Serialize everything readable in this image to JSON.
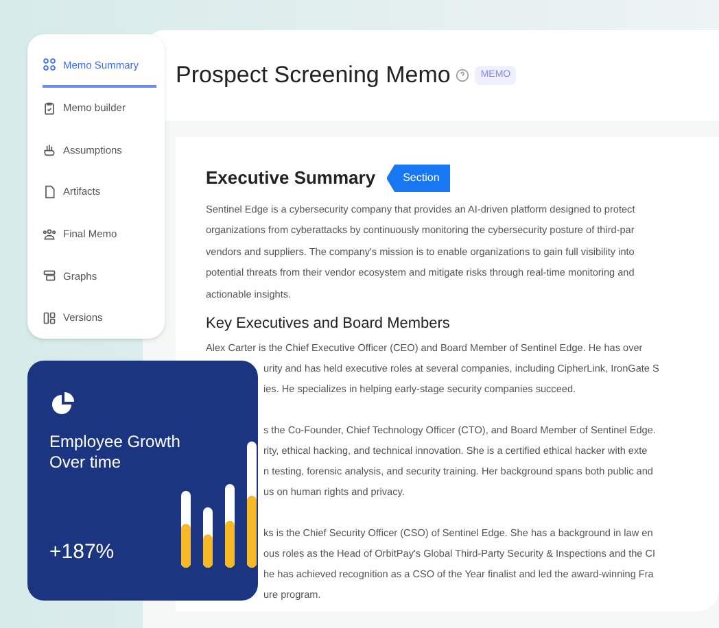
{
  "sidebar": {
    "items": [
      {
        "label": "Memo Summary",
        "selected": true
      },
      {
        "label": "Memo builder",
        "selected": false
      },
      {
        "label": "Assumptions",
        "selected": false
      },
      {
        "label": "Artifacts",
        "selected": false
      },
      {
        "label": "Final Memo",
        "selected": false
      },
      {
        "label": "Graphs",
        "selected": false
      },
      {
        "label": "Versions",
        "selected": false
      }
    ]
  },
  "memo": {
    "title": "Prospect Screening Memo",
    "badge": "MEMO",
    "section_title": "Executive Summary",
    "section_tag": "Section",
    "summary_lines": [
      "Sentinel Edge is a cybersecurity company that provides an AI-driven platform designed to protect",
      "organizations from cyberattacks by continuously monitoring the cybersecurity posture of third-par",
      "vendors and suppliers. The company's mission is to enable organizations to gain full visibility into",
      "potential threats from their vendor ecosystem and mitigate risks through real-time monitoring and",
      "actionable insights."
    ],
    "executives_heading": "Key Executives and Board Members",
    "executive_paragraphs": [
      {
        "lines": [
          "Alex Carter is the Chief Executive Officer (CEO) and Board Member of Sentinel Edge. He has over",
          "urity and has held executive roles at several companies, including CipherLink, IronGate S",
          "ies. He specializes in helping early-stage security companies succeed."
        ]
      },
      {
        "lines": [
          "s the Co-Founder, Chief Technology Officer (CTO), and Board Member of Sentinel Edge.",
          "rity, ethical hacking, and technical innovation. She is a certified ethical hacker with exte",
          "n testing, forensic analysis, and security training. Her background spans both public and",
          "us on human rights and privacy."
        ]
      },
      {
        "lines": [
          "ks is the Chief Security Officer (CSO) of Sentinel Edge. She has a background in law en",
          "ous roles as the Head of OrbitPay's Global Third-Party Security & Inspections and the CI",
          "he has achieved recognition as a CSO of the Year finalist and led the award-winning Fra",
          "ure program."
        ]
      }
    ]
  },
  "stat_card": {
    "title": "Employee Growth Over time",
    "value": "+187%"
  }
}
